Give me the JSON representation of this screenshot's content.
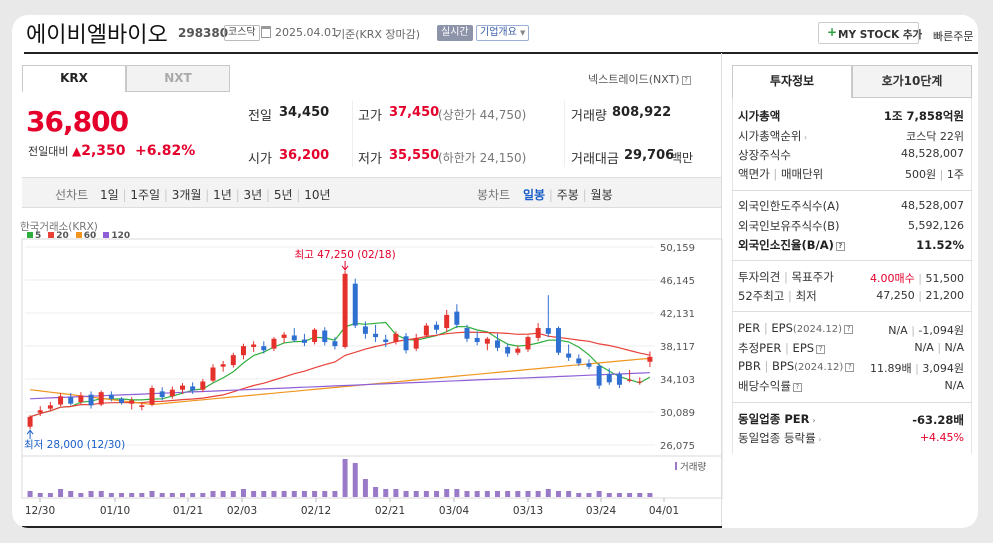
{
  "header": {
    "name": "에이비엘바이오",
    "code": "298380",
    "market": "코스닥",
    "date": "2025.04.01",
    "basis": "기준(KRX 장마감)",
    "realtime": "실시간",
    "company_info": "기업개요",
    "mystock": "MY STOCK 추가",
    "quick_order": "빠른주문"
  },
  "exchange_tabs": {
    "krx": "KRX",
    "nxt": "NXT",
    "nxt_link": "넥스트레이드(NXT)"
  },
  "price": {
    "current": "36,800",
    "change_label": "전일대비",
    "change_arrow": "▲",
    "change": "2,350",
    "change_pct": "+6.82%"
  },
  "stats": {
    "prev_label": "전일",
    "prev": "34,450",
    "high_label": "고가",
    "high": "37,450",
    "upper_limit": "(상한가 44,750)",
    "volume_label": "거래량",
    "volume": "808,922",
    "open_label": "시가",
    "open": "36,200",
    "low_label": "저가",
    "low": "35,550",
    "lower_limit": "(하한가 24,150)",
    "amount_label": "거래대금",
    "amount": "29,706",
    "amount_unit": "백만"
  },
  "line_chart_periods": {
    "label": "선차트",
    "items": [
      "1일",
      "1주일",
      "3개월",
      "1년",
      "3년",
      "5년",
      "10년"
    ]
  },
  "candle_periods": {
    "label": "봉차트",
    "items": [
      "일봉",
      "주봉",
      "월봉"
    ],
    "selected": "일봉"
  },
  "right_tabs": {
    "invest": "투자정보",
    "orderbook": "호가10단계"
  },
  "invest_info": {
    "mcap_label": "시가총액",
    "mcap": "1조 7,858억원",
    "mcap_rank_label": "시가총액순위",
    "mcap_rank": "코스닥 22위",
    "shares_label": "상장주식수",
    "shares": "48,528,007",
    "par_label": "액면가",
    "trade_unit_label": "매매단위",
    "par": "500원",
    "trade_unit": "1주",
    "foreign_limit_label": "외국인한도주식수(A)",
    "foreign_limit": "48,528,007",
    "foreign_hold_label": "외국인보유주식수(B)",
    "foreign_hold": "5,592,126",
    "foreign_ratio_label": "외국인소진율(B/A)",
    "foreign_ratio": "11.52%",
    "opinion_label": "투자의견",
    "target_label": "목표주가",
    "opinion": "4.00매수",
    "target": "51,500",
    "w52_label": "52주최고",
    "w52_low_label": "최저",
    "w52_high": "47,250",
    "w52_low": "21,200",
    "per_label": "PER",
    "eps_label": "EPS",
    "eps_year": "(2024.12)",
    "per": "N/A",
    "eps": "-1,094원",
    "est_per_label": "추정PER",
    "est_eps_label": "EPS",
    "est_per": "N/A",
    "est_eps": "N/A",
    "pbr_label": "PBR",
    "bps_label": "BPS",
    "bps_year": "(2024.12)",
    "pbr": "11.89배",
    "bps": "3,094원",
    "div_label": "배당수익률",
    "div": "N/A",
    "ind_per_label": "동일업종 PER",
    "ind_per": "-63.28배",
    "ind_rate_label": "동일업종 등락률",
    "ind_rate": "+4.45%"
  },
  "chart_data": {
    "type": "candlestick",
    "source": "한국거래소(KRX)",
    "legend": [
      {
        "name": "5",
        "color": "#2eae3c"
      },
      {
        "name": "20",
        "color": "#e8413a"
      },
      {
        "name": "60",
        "color": "#f0961e"
      },
      {
        "name": "120",
        "color": "#8e5fd6"
      }
    ],
    "y_ticks": [
      "50,159",
      "46,145",
      "42,131",
      "38,117",
      "34,103",
      "30,089",
      "26,075"
    ],
    "ylim": [
      26075,
      50159
    ],
    "x_ticks": [
      "12/30",
      "01/10",
      "01/21",
      "02/03",
      "02/12",
      "02/21",
      "03/04",
      "03/13",
      "03/24",
      "04/01"
    ],
    "high_annotation": "최고 47,250 (02/18)",
    "low_annotation": "최저 28,000 (12/30)",
    "volume_label": "거래량",
    "up_color": "#e4312b",
    "down_color": "#2f6fd0",
    "candles": [
      {
        "o": 28300,
        "h": 29700,
        "l": 28000,
        "c": 29500
      },
      {
        "o": 30000,
        "h": 30800,
        "l": 29600,
        "c": 30300
      },
      {
        "o": 30500,
        "h": 31300,
        "l": 30200,
        "c": 30900
      },
      {
        "o": 31000,
        "h": 32400,
        "l": 30800,
        "c": 32000
      },
      {
        "o": 31900,
        "h": 32400,
        "l": 30900,
        "c": 31100
      },
      {
        "o": 31300,
        "h": 32500,
        "l": 31000,
        "c": 32100
      },
      {
        "o": 32200,
        "h": 32600,
        "l": 30500,
        "c": 30900
      },
      {
        "o": 31000,
        "h": 32700,
        "l": 30800,
        "c": 32500
      },
      {
        "o": 32200,
        "h": 32600,
        "l": 31400,
        "c": 31700
      },
      {
        "o": 31700,
        "h": 31900,
        "l": 31000,
        "c": 31200
      },
      {
        "o": 31100,
        "h": 31900,
        "l": 30400,
        "c": 31500
      },
      {
        "o": 30700,
        "h": 31300,
        "l": 30300,
        "c": 30900
      },
      {
        "o": 31000,
        "h": 33300,
        "l": 30800,
        "c": 33000
      },
      {
        "o": 32600,
        "h": 33100,
        "l": 31500,
        "c": 31900
      },
      {
        "o": 32000,
        "h": 33200,
        "l": 31700,
        "c": 32800
      },
      {
        "o": 32800,
        "h": 33600,
        "l": 32300,
        "c": 33300
      },
      {
        "o": 33200,
        "h": 33700,
        "l": 32300,
        "c": 32700
      },
      {
        "o": 32800,
        "h": 34100,
        "l": 32500,
        "c": 33800
      },
      {
        "o": 33900,
        "h": 35900,
        "l": 33700,
        "c": 35500
      },
      {
        "o": 35600,
        "h": 36300,
        "l": 35000,
        "c": 35900
      },
      {
        "o": 35800,
        "h": 37300,
        "l": 35500,
        "c": 37000
      },
      {
        "o": 37000,
        "h": 38400,
        "l": 36500,
        "c": 38100
      },
      {
        "o": 38000,
        "h": 38700,
        "l": 37400,
        "c": 38300
      },
      {
        "o": 38100,
        "h": 38700,
        "l": 37200,
        "c": 37600
      },
      {
        "o": 37800,
        "h": 39200,
        "l": 37500,
        "c": 39000
      },
      {
        "o": 39100,
        "h": 39800,
        "l": 38500,
        "c": 39500
      },
      {
        "o": 39400,
        "h": 40300,
        "l": 38600,
        "c": 38800
      },
      {
        "o": 38900,
        "h": 39600,
        "l": 38100,
        "c": 38500
      },
      {
        "o": 38600,
        "h": 40300,
        "l": 38300,
        "c": 40100
      },
      {
        "o": 40000,
        "h": 40400,
        "l": 38200,
        "c": 38600
      },
      {
        "o": 38700,
        "h": 39200,
        "l": 37700,
        "c": 38100
      },
      {
        "o": 38000,
        "h": 47250,
        "l": 37800,
        "c": 46900
      },
      {
        "o": 45700,
        "h": 46300,
        "l": 40300,
        "c": 40600
      },
      {
        "o": 40500,
        "h": 41100,
        "l": 39000,
        "c": 39600
      },
      {
        "o": 39600,
        "h": 40700,
        "l": 38600,
        "c": 39200
      },
      {
        "o": 38900,
        "h": 39500,
        "l": 38000,
        "c": 38600
      },
      {
        "o": 38600,
        "h": 39900,
        "l": 38300,
        "c": 39600
      },
      {
        "o": 39300,
        "h": 39700,
        "l": 37200,
        "c": 37600
      },
      {
        "o": 37800,
        "h": 39600,
        "l": 37500,
        "c": 39100
      },
      {
        "o": 39400,
        "h": 40900,
        "l": 39200,
        "c": 40600
      },
      {
        "o": 40700,
        "h": 41100,
        "l": 39600,
        "c": 40100
      },
      {
        "o": 40300,
        "h": 42500,
        "l": 39800,
        "c": 41900
      },
      {
        "o": 42300,
        "h": 43200,
        "l": 40300,
        "c": 40700
      },
      {
        "o": 40300,
        "h": 40700,
        "l": 38600,
        "c": 39000
      },
      {
        "o": 39100,
        "h": 39900,
        "l": 38200,
        "c": 38600
      },
      {
        "o": 38400,
        "h": 39200,
        "l": 37600,
        "c": 39000
      },
      {
        "o": 38800,
        "h": 39600,
        "l": 37500,
        "c": 37900
      },
      {
        "o": 38000,
        "h": 38400,
        "l": 36800,
        "c": 37200
      },
      {
        "o": 37300,
        "h": 38200,
        "l": 37000,
        "c": 37800
      },
      {
        "o": 37700,
        "h": 39400,
        "l": 37400,
        "c": 39200
      },
      {
        "o": 39100,
        "h": 40900,
        "l": 38700,
        "c": 40300
      },
      {
        "o": 40300,
        "h": 44300,
        "l": 39200,
        "c": 39600
      },
      {
        "o": 40300,
        "h": 40500,
        "l": 37000,
        "c": 37300
      },
      {
        "o": 37200,
        "h": 38300,
        "l": 36300,
        "c": 36700
      },
      {
        "o": 36600,
        "h": 37100,
        "l": 35700,
        "c": 36000
      },
      {
        "o": 36000,
        "h": 36500,
        "l": 35300,
        "c": 35600
      },
      {
        "o": 35700,
        "h": 36000,
        "l": 32900,
        "c": 33300
      },
      {
        "o": 34700,
        "h": 35400,
        "l": 33400,
        "c": 33700
      },
      {
        "o": 34700,
        "h": 35000,
        "l": 33000,
        "c": 33400
      },
      {
        "o": 34000,
        "h": 35200,
        "l": 33700,
        "c": 34000
      },
      {
        "o": 33700,
        "h": 34300,
        "l": 33400,
        "c": 33800
      },
      {
        "o": 36200,
        "h": 37450,
        "l": 35550,
        "c": 36800
      }
    ],
    "volumes": [
      3,
      2,
      2,
      4,
      3,
      2,
      3,
      3,
      2,
      2,
      2,
      2,
      3,
      2,
      2,
      2,
      2,
      2,
      3,
      3,
      3,
      4,
      3,
      3,
      3,
      3,
      3,
      3,
      3,
      3,
      3,
      19,
      17,
      9,
      5,
      4,
      4,
      3,
      3,
      3,
      3,
      4,
      4,
      3,
      3,
      3,
      3,
      3,
      3,
      3,
      3,
      4,
      3,
      3,
      2,
      2,
      3,
      2,
      2,
      2,
      2,
      2
    ]
  }
}
